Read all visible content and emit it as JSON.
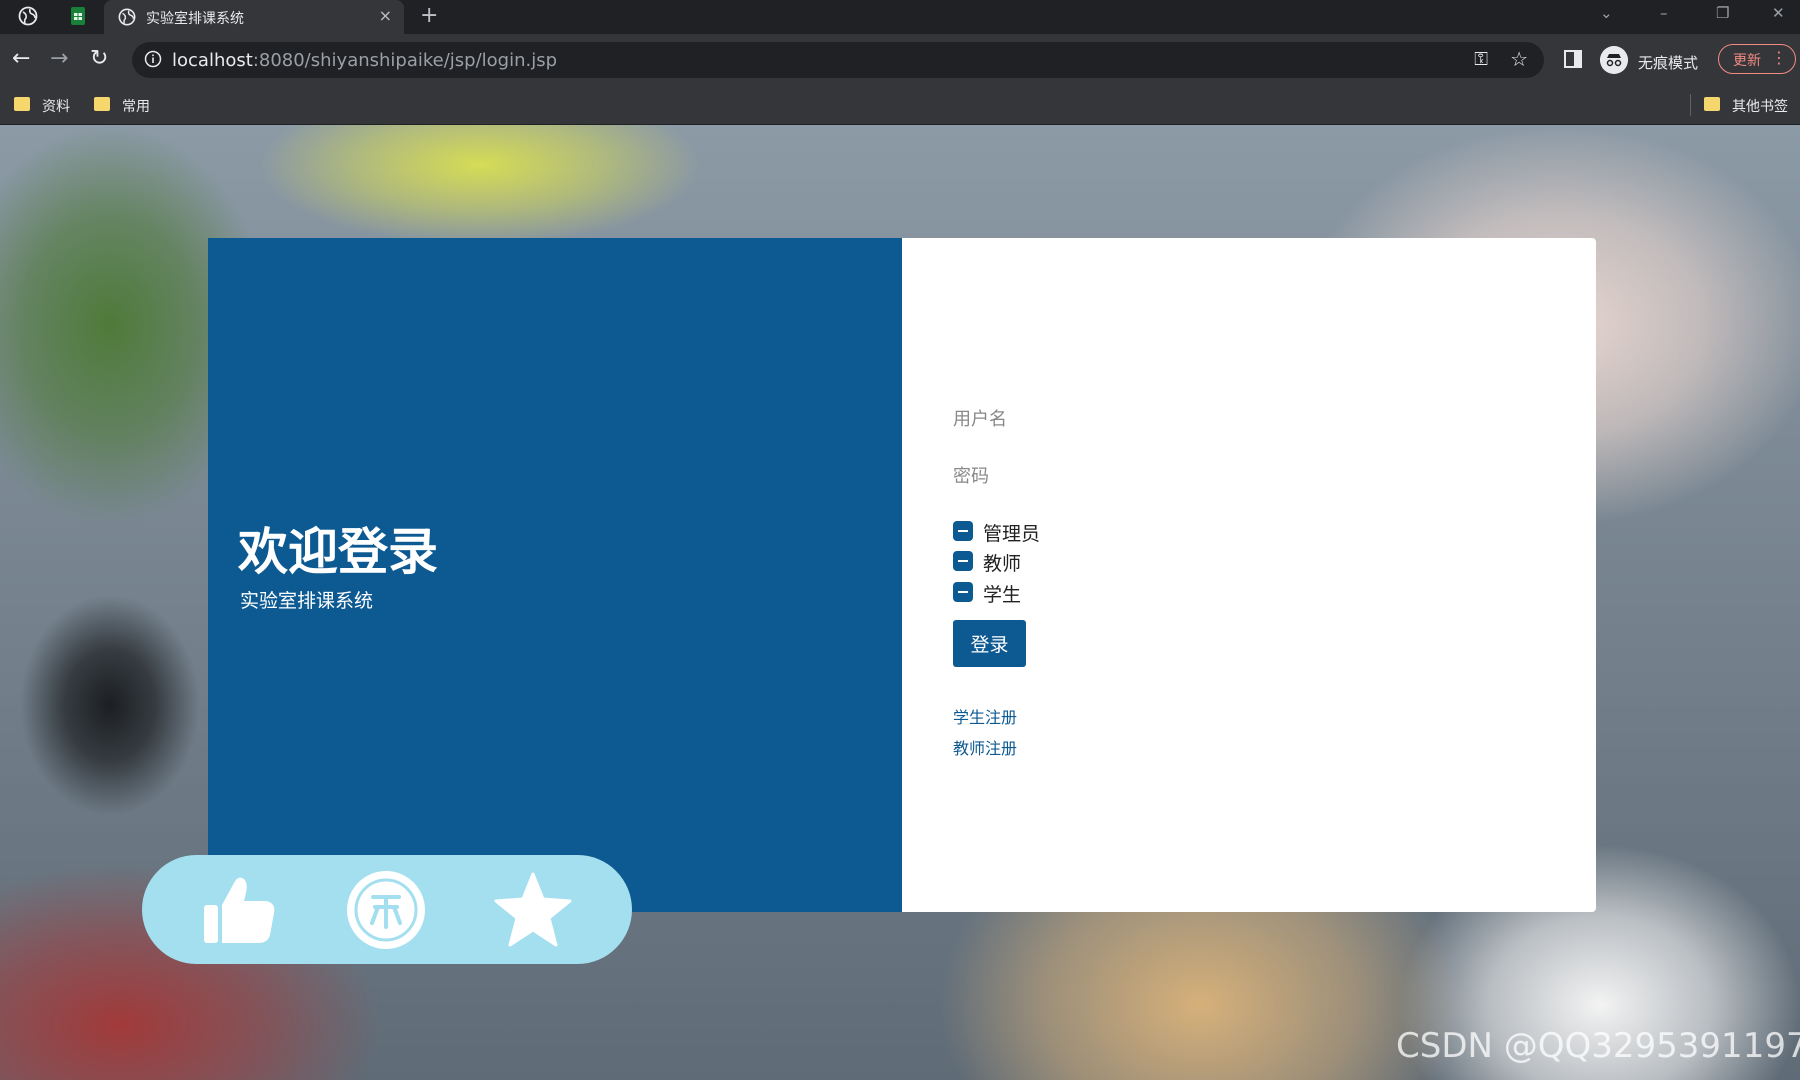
{
  "browser": {
    "tab": {
      "title": "实验室排课系统",
      "close": "×"
    },
    "new_tab": "+",
    "window_controls": {
      "dropdown": "⌄",
      "minimize": "–",
      "restore": "❐",
      "close": "✕"
    },
    "nav": {
      "back": "←",
      "forward": "→",
      "reload": "↻"
    },
    "url": {
      "host": "localhost",
      "rest": ":8080/shiyanshipaike/jsp/login.jsp"
    },
    "incognito_label": "无痕模式",
    "update_label": "更新",
    "bookmarks": [
      {
        "label": "资料"
      },
      {
        "label": "常用"
      }
    ],
    "other_bookmarks": "其他书签",
    "colors": {
      "frame": "#202124",
      "toolbar": "#35363a",
      "folder": "#f5d76e",
      "update": "#f28b82"
    }
  },
  "login": {
    "welcome_title": "欢迎登录",
    "subtitle": "实验室排课系统",
    "username_label": "用户名",
    "password_label": "密码",
    "roles": [
      {
        "label": "管理员",
        "checked": "indeterminate"
      },
      {
        "label": "教师",
        "checked": "indeterminate"
      },
      {
        "label": "学生",
        "checked": "indeterminate"
      }
    ],
    "login_button": "登录",
    "register_links": [
      {
        "label": "学生注册"
      },
      {
        "label": "教师注册"
      }
    ],
    "colors": {
      "brand": "#0d5a93",
      "panel": "#ffffff"
    }
  },
  "overlay": {
    "actions": [
      {
        "icon": "thumbs-up-icon"
      },
      {
        "icon": "coin-icon"
      },
      {
        "icon": "star-icon"
      }
    ],
    "colors": {
      "pill": "#a3dfee",
      "icon": "#ffffff"
    }
  },
  "watermark": "CSDN @QQ3295391197"
}
